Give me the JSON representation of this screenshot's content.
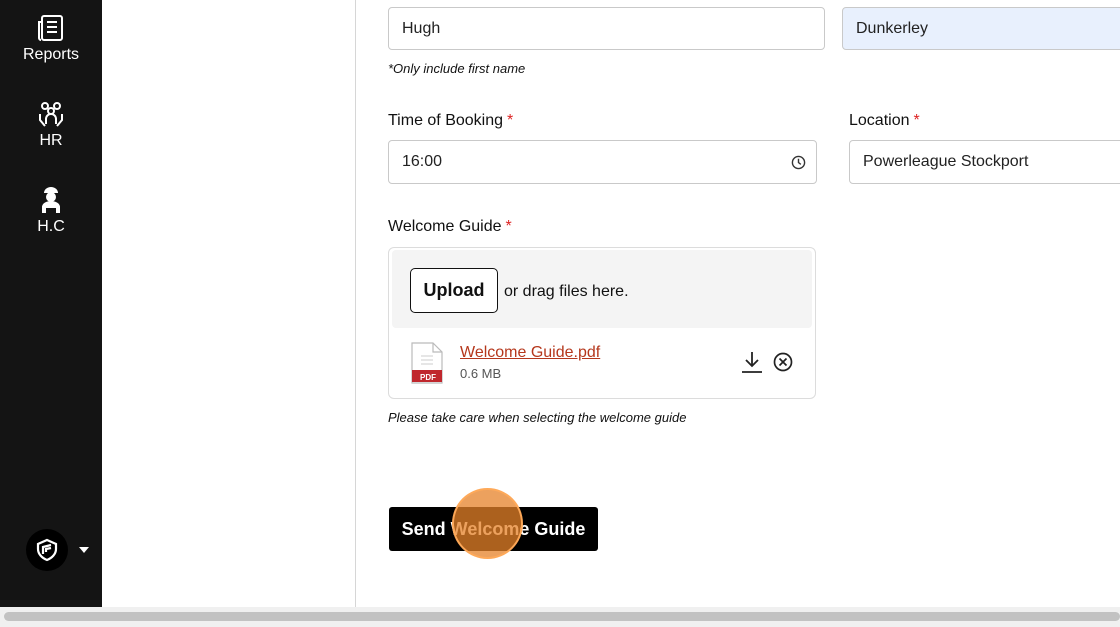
{
  "sidebar": {
    "items": [
      {
        "label": "Reports",
        "icon": "reports-icon"
      },
      {
        "label": "HR",
        "icon": "hr-people-icon"
      },
      {
        "label": "H.C",
        "icon": "person-icon"
      }
    ],
    "logo_icon": "shield-logo-icon"
  },
  "form": {
    "first_name": {
      "value": "Hugh"
    },
    "last_name": {
      "value": "Dunkerley"
    },
    "first_name_hint": "*Only include first name",
    "time_of_booking": {
      "label": "Time of Booking",
      "required": "*",
      "value": "16:00"
    },
    "location": {
      "label": "Location",
      "required": "*",
      "value": "Powerleague Stockport"
    },
    "welcome_guide": {
      "label": "Welcome Guide",
      "required": "*",
      "upload_label": "Upload",
      "drag_text": "or drag files here.",
      "file": {
        "name": "Welcome Guide.pdf",
        "size": "0.6 MB",
        "type_badge": "PDF"
      },
      "hint": "Please take care when selecting the welcome guide"
    },
    "submit_label": "Send Welcome Guide"
  },
  "colors": {
    "sidebar_bg": "#141414",
    "required": "#dd2222",
    "file_link": "#b5371c",
    "highlight_field": "#e8f0fd",
    "click_indicator": "#e68228"
  }
}
